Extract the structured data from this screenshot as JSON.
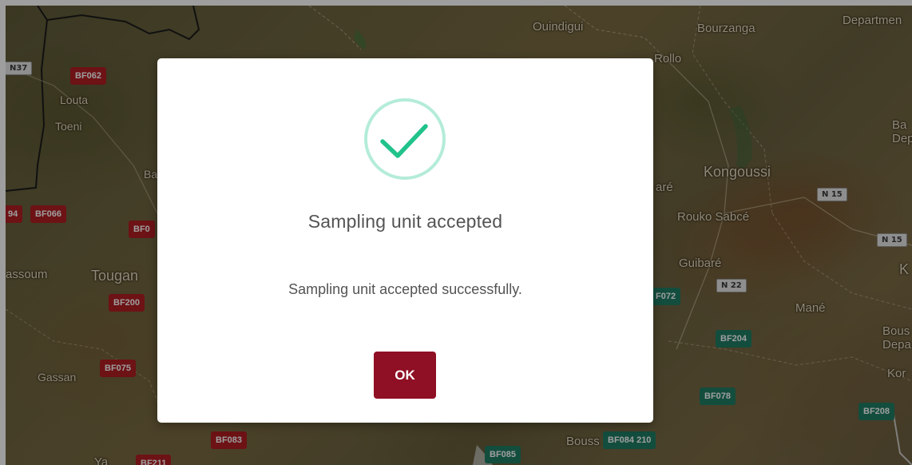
{
  "map": {
    "places": [
      {
        "id": "quindigui",
        "label": "Ouindigui"
      },
      {
        "id": "bourzanga",
        "label": "Bourzanga"
      },
      {
        "id": "department-top",
        "label": "Departmen"
      },
      {
        "id": "rollo",
        "label": "Rollo"
      },
      {
        "id": "louta",
        "label": "Louta"
      },
      {
        "id": "toeni",
        "label": "Toeni"
      },
      {
        "id": "ba-left",
        "label": "Ba"
      },
      {
        "id": "kongoussi",
        "label": "Kongoussi"
      },
      {
        "id": "are",
        "label": "aré"
      },
      {
        "id": "rouko-sabce",
        "label": "Rouko Sabcé"
      },
      {
        "id": "guibare",
        "label": "Guibaré"
      },
      {
        "id": "mane",
        "label": "Mané"
      },
      {
        "id": "ba-dep-right",
        "label": "Ba\nDep"
      },
      {
        "id": "k-right",
        "label": "K"
      },
      {
        "id": "bous-dep-right",
        "label": "Bous\nDepa"
      },
      {
        "id": "kor-right",
        "label": "Kor"
      },
      {
        "id": "assoum",
        "label": "assoum"
      },
      {
        "id": "tougan",
        "label": "Tougan"
      },
      {
        "id": "gassan",
        "label": "Gassan"
      },
      {
        "id": "bouss-bottom",
        "label": "Bouss"
      },
      {
        "id": "ya-bottom",
        "label": "Ya"
      }
    ],
    "roads": [
      {
        "id": "n37",
        "label": "N37"
      },
      {
        "id": "n15-a",
        "label": "N 15"
      },
      {
        "id": "n15-b",
        "label": "N 15"
      },
      {
        "id": "n22",
        "label": "N 22"
      }
    ],
    "markers": [
      {
        "id": "bf062",
        "label": "BF062",
        "status": "red"
      },
      {
        "id": "bf094",
        "label": "94",
        "status": "red"
      },
      {
        "id": "bf066",
        "label": "BF066",
        "status": "red"
      },
      {
        "id": "bf0-partial",
        "label": "BF0",
        "status": "red"
      },
      {
        "id": "bf200",
        "label": "BF200",
        "status": "red"
      },
      {
        "id": "bf075",
        "label": "BF075",
        "status": "red"
      },
      {
        "id": "bf083",
        "label": "BF083",
        "status": "red"
      },
      {
        "id": "bf211",
        "label": "BF211",
        "status": "red"
      },
      {
        "id": "bf072",
        "label": "F072",
        "status": "green"
      },
      {
        "id": "bf204",
        "label": "BF204",
        "status": "green"
      },
      {
        "id": "bf078",
        "label": "BF078",
        "status": "green"
      },
      {
        "id": "bf208",
        "label": "BF208",
        "status": "green"
      },
      {
        "id": "bf085",
        "label": "BF085",
        "status": "green"
      },
      {
        "id": "bf084-210",
        "label": "BF084 210",
        "status": "green"
      }
    ]
  },
  "dialog": {
    "icon": "check-circle-icon",
    "title": "Sampling unit accepted",
    "message": "Sampling unit accepted successfully.",
    "ok_label": "OK",
    "colors": {
      "check": "#21c38a",
      "ring": "#b4ecd8",
      "ok_button": "#8f0f24"
    }
  }
}
